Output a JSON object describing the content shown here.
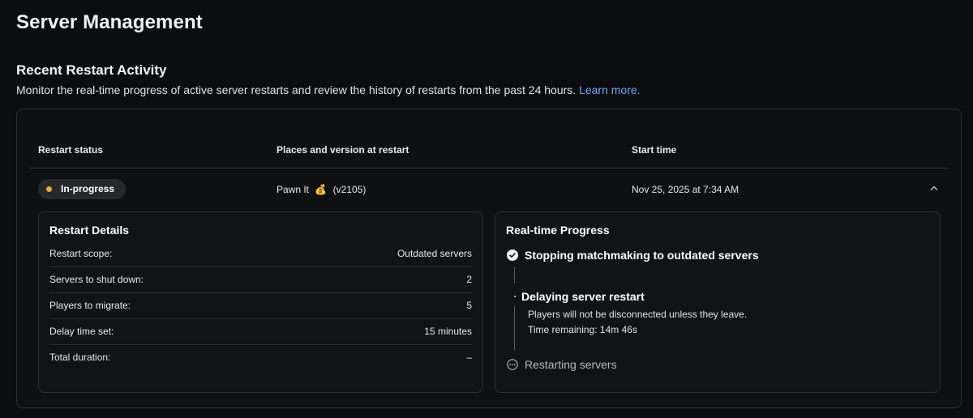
{
  "page": {
    "title": "Server Management"
  },
  "section": {
    "title": "Recent Restart Activity",
    "description": "Monitor the real-time progress of active server restarts and review the history of restarts from the past 24 hours.",
    "learn_more": "Learn more."
  },
  "table": {
    "headers": {
      "status": "Restart status",
      "places": "Places and version at restart",
      "start": "Start time"
    },
    "row": {
      "status": "In-progress",
      "place_name": "Pawn It",
      "place_emoji": "💰",
      "version": "(v2105)",
      "start_time": "Nov 25, 2025 at 7:34 AM"
    }
  },
  "details": {
    "title": "Restart Details",
    "rows": [
      {
        "label": "Restart scope:",
        "value": "Outdated servers"
      },
      {
        "label": "Servers to shut down:",
        "value": "2"
      },
      {
        "label": "Players to migrate:",
        "value": "5"
      },
      {
        "label": "Delay time set:",
        "value": "15 minutes"
      },
      {
        "label": "Total duration:",
        "value": "–"
      }
    ]
  },
  "progress": {
    "title": "Real-time Progress",
    "steps": [
      {
        "title": "Stopping matchmaking to outdated servers",
        "state": "done"
      },
      {
        "title": "Delaying server restart",
        "state": "active",
        "note": "Players will not be disconnected unless they leave.",
        "time_remaining": "Time remaining: 14m 46s"
      },
      {
        "title": "Restarting servers",
        "state": "pending"
      }
    ]
  },
  "colors": {
    "background": "#0c0d0f",
    "link": "#6fa4ff",
    "status_in_progress": "#f0a735"
  }
}
